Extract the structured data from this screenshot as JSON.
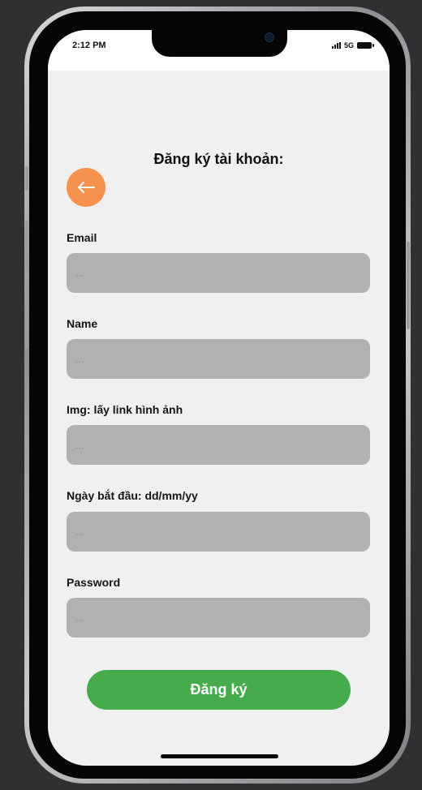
{
  "status_bar": {
    "time": "2:12 PM",
    "network": "5G"
  },
  "header": {
    "title": "Đăng ký tài khoản:",
    "back_icon": "arrow-left-icon"
  },
  "form": {
    "fields": [
      {
        "label": "Email",
        "placeholder": "..."
      },
      {
        "label": "Name",
        "placeholder": "..."
      },
      {
        "label": "Img: lấy link hình ảnh",
        "placeholder": "..."
      },
      {
        "label": "Ngày bắt đầu: dd/mm/yy",
        "placeholder": "..."
      },
      {
        "label": "Password",
        "placeholder": "..."
      }
    ],
    "submit_label": "Đăng ký"
  },
  "colors": {
    "back_button": "#f7924e",
    "submit_button": "#46ab4b",
    "input_background": "#b3b0b0",
    "screen_background": "#f0f0f0"
  }
}
